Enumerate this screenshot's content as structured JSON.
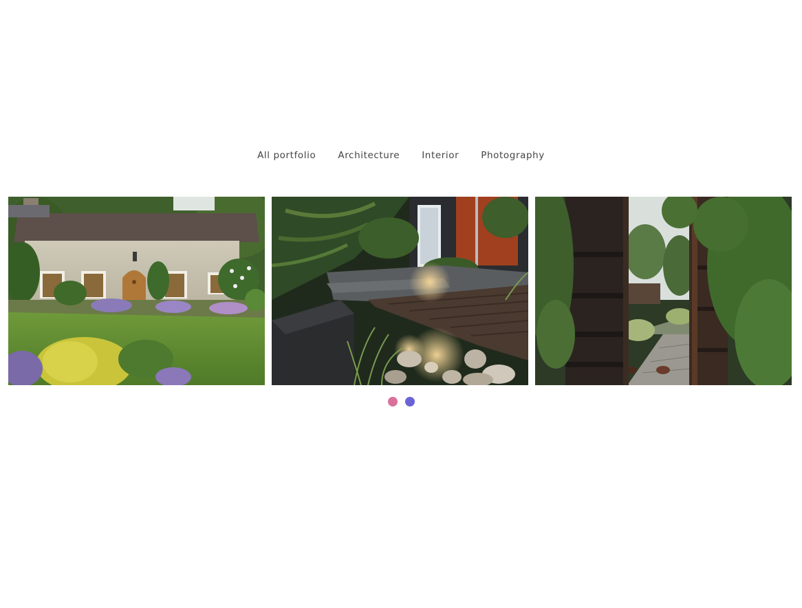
{
  "filters": {
    "items": [
      {
        "label": "All portfolio"
      },
      {
        "label": "Architecture"
      },
      {
        "label": "Interior"
      },
      {
        "label": "Photography"
      }
    ]
  },
  "slider": {
    "slides": [
      {
        "subject": "stone-cottage-with-garden"
      },
      {
        "subject": "lit-garden-deck-with-stones"
      },
      {
        "subject": "wooden-gate-to-garden-path"
      }
    ],
    "pagination": {
      "dots": [
        {
          "color": "#d9719a",
          "state": "active"
        },
        {
          "color": "#6b64d6",
          "state": "inactive"
        }
      ]
    }
  }
}
